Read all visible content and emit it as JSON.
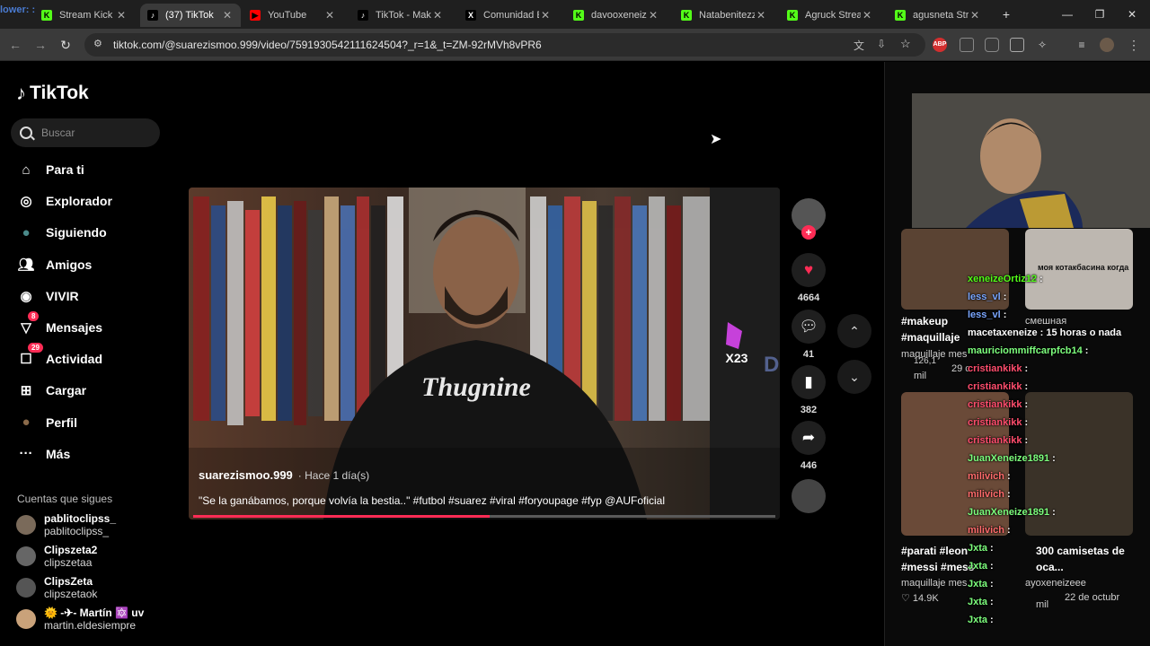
{
  "browser": {
    "overlay_text": "lower: :",
    "tabs": [
      {
        "title": "Stream Kick",
        "fav": "K",
        "favColor": "#53fc18"
      },
      {
        "title": "(37) TikTok",
        "fav": "♪",
        "favColor": "#000"
      },
      {
        "title": "YouTube",
        "fav": "▶",
        "favColor": "#ff0000"
      },
      {
        "title": "TikTok - Make",
        "fav": "♪",
        "favColor": "#000"
      },
      {
        "title": "Comunidad El",
        "fav": "X",
        "favColor": "#000"
      },
      {
        "title": "davooxeneize",
        "fav": "K",
        "favColor": "#53fc18"
      },
      {
        "title": "Natabenitezzz",
        "fav": "K",
        "favColor": "#53fc18"
      },
      {
        "title": "Agruck Stream",
        "fav": "K",
        "favColor": "#53fc18"
      },
      {
        "title": "agusneta Strea",
        "fav": "K",
        "favColor": "#53fc18"
      }
    ],
    "url": "tiktok.com/@suarezismoo.999/video/7591930542111624504?_r=1&_t=ZM-92rMVh8vPR6"
  },
  "tiktok": {
    "logo": "TikTok",
    "search_placeholder": "Buscar",
    "nav": [
      {
        "label": "Para ti",
        "icon": "home-icon"
      },
      {
        "label": "Explorador",
        "icon": "compass-icon"
      },
      {
        "label": "Siguiendo",
        "icon": "following-icon"
      },
      {
        "label": "Amigos",
        "icon": "friends-icon"
      },
      {
        "label": "VIVIR",
        "icon": "live-icon"
      },
      {
        "label": "Mensajes",
        "icon": "messages-icon",
        "badge": "8"
      },
      {
        "label": "Actividad",
        "icon": "activity-icon",
        "badge": "29"
      },
      {
        "label": "Cargar",
        "icon": "upload-icon"
      },
      {
        "label": "Perfil",
        "icon": "profile-icon"
      },
      {
        "label": "Más",
        "icon": "more-icon"
      }
    ],
    "following_title": "Cuentas que sigues",
    "following": [
      {
        "name": "pablitoclipss_",
        "handle": "pablitoclipss_"
      },
      {
        "name": "Clipszeta2",
        "handle": "clipszetaa"
      },
      {
        "name": "ClipsZeta",
        "handle": "clipszetaok"
      },
      {
        "name": "🌞 -✈- Martín 🔯 uv",
        "handle": "martin.eldesiempre"
      }
    ],
    "video": {
      "author": "suarezismoo.999",
      "time": "· Hace 1 día(s)",
      "caption": "\"Se la ganábamos, porque volvía la bestia..\" #futbol #suarez #viral #foryoupage #fyp @AUFoficial",
      "shirt_text": "Thugnine",
      "progress": 0.51
    },
    "actions": {
      "likes": "4664",
      "comments": "41",
      "saves": "382",
      "shares": "446"
    }
  },
  "right_panel": {
    "card1_tags": "#makeup",
    "card1_tags2": "#maquillaje",
    "card1_sub": "maquillaje mes",
    "card1_count": "126,1",
    "card1_count2": "mil",
    "card1_date": "29 c",
    "card_overlay_text": "моя котакбасина когда",
    "card_overlay_text2": "смешная",
    "card2_tags": "#parati #leon",
    "card2_tags2": "#messi #mess",
    "card2_sub": "maquillaje mes",
    "card2_count": "14.9K",
    "card2_date": "22 de octubr",
    "card2_right_title": "300 camisetas de",
    "card2_right_title2": "oca...",
    "card2_right_user": "ayoxeneizeee",
    "card2_right_count": "mil",
    "chat": [
      {
        "user": "xeneizeOrtiz12",
        "msg": ":",
        "color": "#53fc18"
      },
      {
        "user": "less_vl",
        "msg": ":",
        "color": "#7aa6ff"
      },
      {
        "user": "less_vl",
        "msg": ":",
        "color": "#7aa6ff"
      },
      {
        "user": "macetaxeneize",
        "msg": ": 15 horas o nada",
        "color": "#fff"
      },
      {
        "user": "mauriciommiffcarpfcb14",
        "msg": ":",
        "color": "#7dff7d"
      },
      {
        "user": "cristiankikk",
        "msg": ":",
        "color": "#ff4d6d"
      },
      {
        "user": "cristiankikk",
        "msg": ":",
        "color": "#ff4d6d"
      },
      {
        "user": "cristiankikk",
        "msg": ":",
        "color": "#ff4d6d"
      },
      {
        "user": "cristiankikk",
        "msg": ":",
        "color": "#ff4d6d"
      },
      {
        "user": "cristiankikk",
        "msg": ":",
        "color": "#ff4d6d"
      },
      {
        "user": "JuanXeneize1891",
        "msg": ":",
        "color": "#7dff7d"
      },
      {
        "user": "milivich",
        "msg": ":",
        "color": "#ff6b6b"
      },
      {
        "user": "milivich",
        "msg": ":",
        "color": "#ff6b6b"
      },
      {
        "user": "JuanXeneize1891",
        "msg": ":",
        "color": "#7dff7d"
      },
      {
        "user": "milivich",
        "msg": ":",
        "color": "#ff6b6b"
      },
      {
        "user": "Jxta",
        "msg": ":",
        "color": "#7dff7d"
      },
      {
        "user": "Jxta",
        "msg": ":",
        "color": "#7dff7d"
      },
      {
        "user": "Jxta",
        "msg": ":",
        "color": "#7dff7d"
      },
      {
        "user": "Jxta",
        "msg": ":",
        "color": "#7dff7d"
      },
      {
        "user": "Jxta",
        "msg": ":",
        "color": "#7dff7d"
      }
    ]
  }
}
